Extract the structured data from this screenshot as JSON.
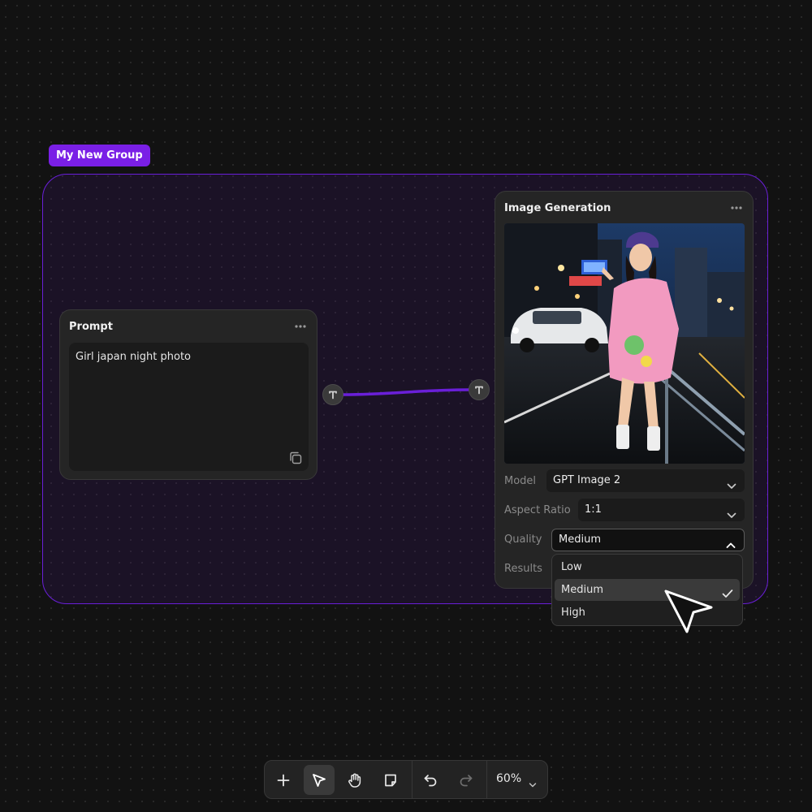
{
  "group": {
    "label": "My New Group",
    "color": "#7a1fe6"
  },
  "prompt_node": {
    "title": "Prompt",
    "menu_icon": "more-horizontal-icon",
    "text": "Girl japan night photo",
    "copy_icon": "copy-icon"
  },
  "ports": {
    "output_icon": "text-port-icon",
    "input_icon": "text-port-icon"
  },
  "image_node": {
    "title": "Image Generation",
    "menu_icon": "more-horizontal-icon",
    "image_alt": "generated-image",
    "fields": {
      "model": {
        "label": "Model",
        "value": "GPT Image 2"
      },
      "aspect_ratio": {
        "label": "Aspect Ratio",
        "value": "1:1"
      },
      "quality": {
        "label": "Quality",
        "value": "Medium"
      },
      "results": {
        "label": "Results"
      }
    }
  },
  "quality_dropdown": {
    "options": [
      "Low",
      "Medium",
      "High"
    ],
    "selected": "Medium"
  },
  "toolbar": {
    "buttons": [
      "add-icon",
      "select-pointer-icon",
      "hand-pan-icon",
      "note-icon",
      "undo-icon",
      "redo-icon"
    ],
    "active": "select-pointer-icon",
    "zoom": "60%"
  }
}
